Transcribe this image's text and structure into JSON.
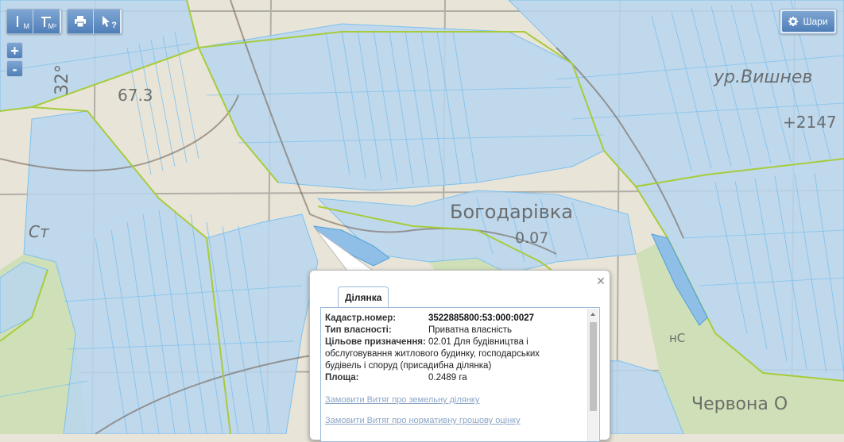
{
  "toolbar": {
    "measure_distance": {
      "icon": "ruler-distance-icon",
      "sub": "M"
    },
    "measure_area": {
      "icon": "ruler-area-icon",
      "sub": "M²"
    },
    "print": {
      "icon": "printer-icon"
    },
    "identify": {
      "icon": "pointer-help-icon",
      "sub": "?"
    }
  },
  "zoom": {
    "in": "+",
    "out": "-"
  },
  "layers": {
    "label": "Шари",
    "icon": "gear-icon"
  },
  "map_labels": {
    "village": "Богодарівка",
    "village_number": "0.07",
    "street": "ур.Вишнев",
    "red_road": "Червона О",
    "grid_left": "32°",
    "elev_1": "67.3",
    "place_ct": "Ст",
    "elev_2": "+2147",
    "place_unk": "нС"
  },
  "popup": {
    "tab": "Ділянка",
    "cadastral_label": "Кадастр.номер:",
    "cadastral_value": "3522885800:53:000:0027",
    "ownership_label": "Тип власності:",
    "ownership_value": "Приватна власність",
    "purpose_label": "Цільове призначення:",
    "purpose_value_line1": "02.01 Для будівництва і",
    "purpose_value_rest": "обслуговування житлового будинку, господарських будівель і споруд (присадибна ділянка)",
    "area_label": "Площа:",
    "area_value": "0.2489 га",
    "link_extract": "Замовити Витяг про земельну ділянку",
    "link_valuation": "Замовити Витяг про нормативну грошову оцінку"
  },
  "colors": {
    "parcel_fill": "#b9d6ef",
    "parcel_line": "#7cc1ee",
    "boundary": "#a6cc3c",
    "forest": "#cfe0b8",
    "base": "#e9e4d8",
    "button": "#5f8ec6"
  }
}
